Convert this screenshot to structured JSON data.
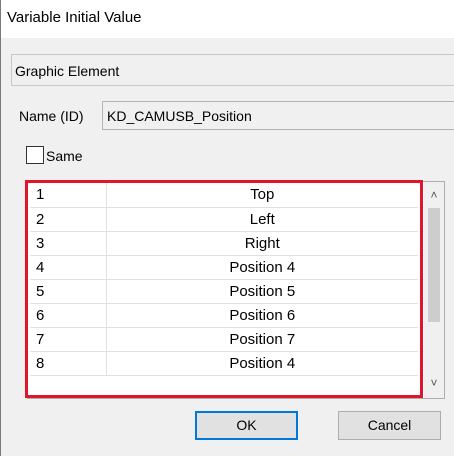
{
  "window": {
    "title": "Variable Initial Value"
  },
  "group": {
    "label": "Graphic Element"
  },
  "name_field": {
    "label": "Name (ID)",
    "value": "KD_CAMUSB_Position"
  },
  "same_checkbox": {
    "label": "Same",
    "checked": false
  },
  "list": {
    "rows": [
      {
        "index": "1",
        "value": "Top"
      },
      {
        "index": "2",
        "value": "Left"
      },
      {
        "index": "3",
        "value": "Right"
      },
      {
        "index": "4",
        "value": "Position 4"
      },
      {
        "index": "5",
        "value": "Position 5"
      },
      {
        "index": "6",
        "value": "Position 6"
      },
      {
        "index": "7",
        "value": "Position 7"
      },
      {
        "index": "8",
        "value": "Position 4"
      }
    ]
  },
  "scrollbar": {
    "up_icon": "chevron-up-icon",
    "down_icon": "chevron-down-icon"
  },
  "buttons": {
    "ok": "OK",
    "cancel": "Cancel"
  },
  "colors": {
    "highlight": "#e0142a",
    "default_button_border": "#0078d7"
  }
}
